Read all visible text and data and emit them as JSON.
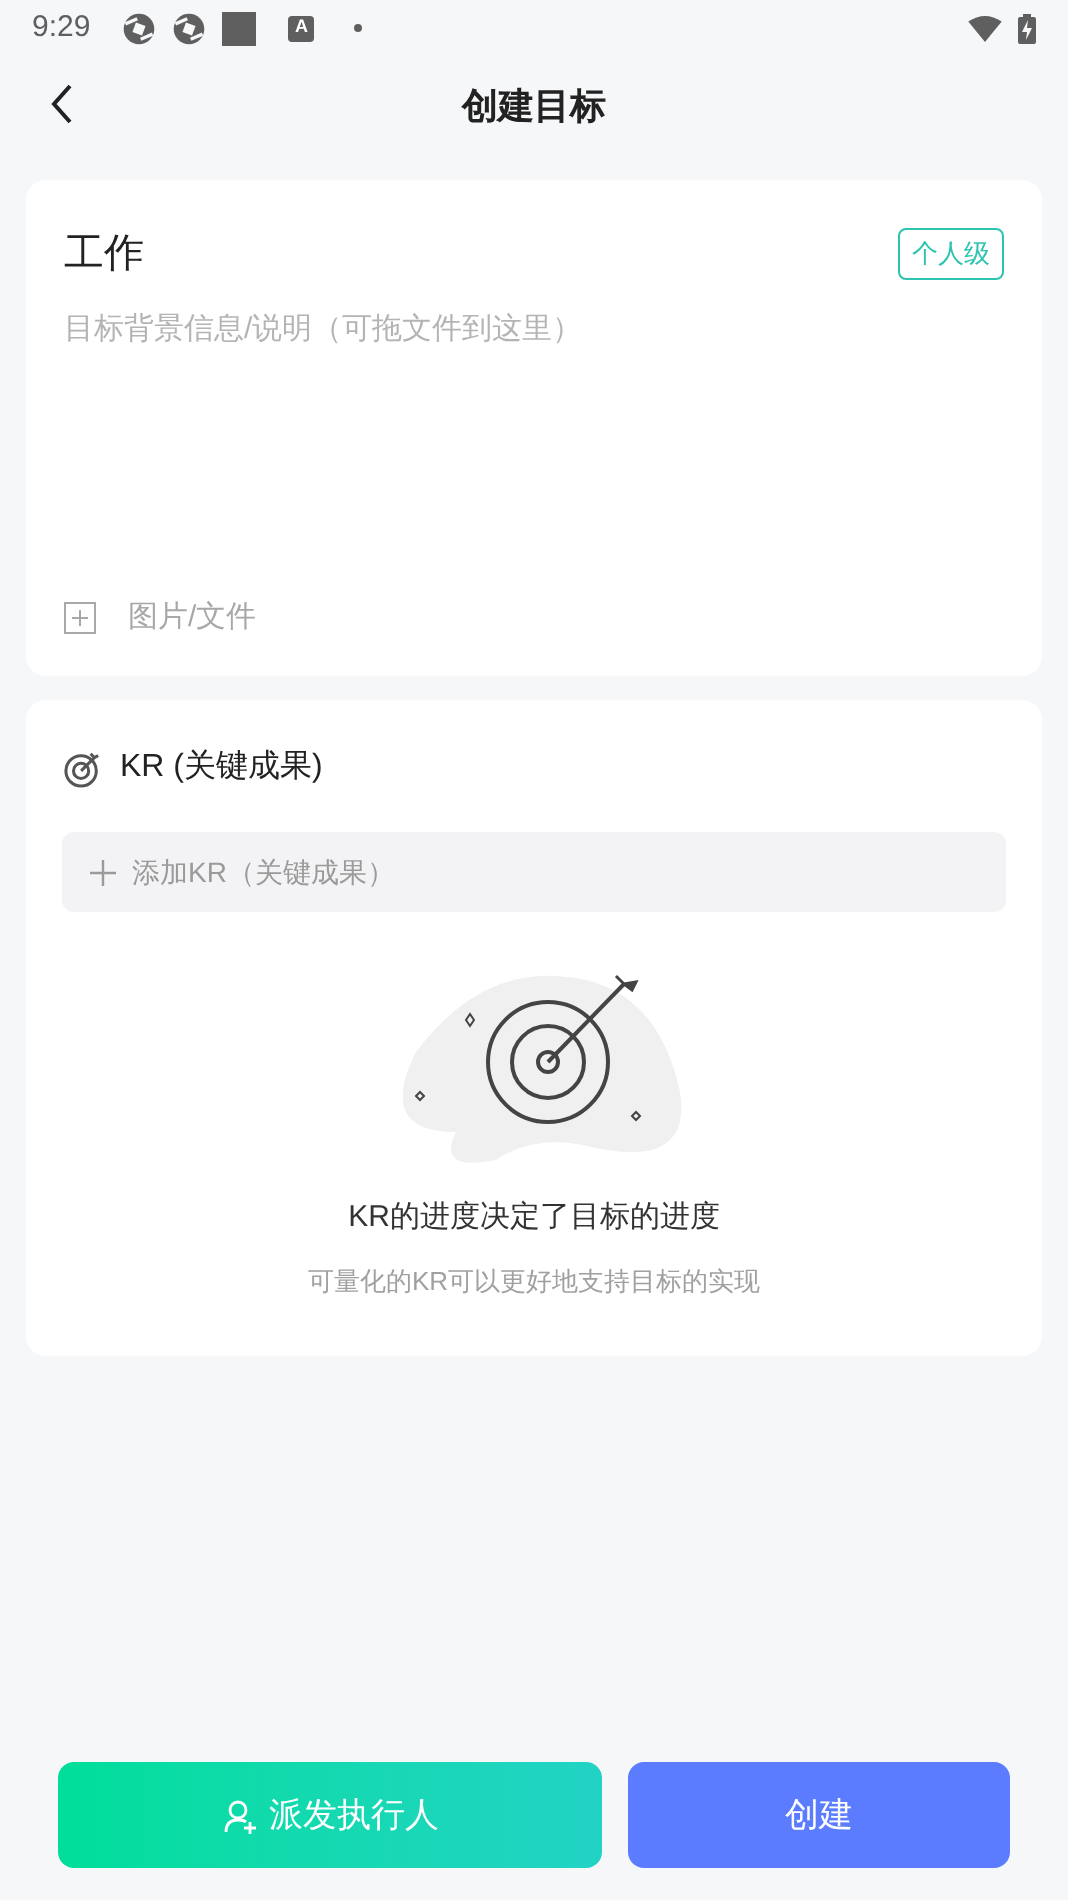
{
  "status_bar": {
    "time": "9:29",
    "app_badge_letter": "A"
  },
  "header": {
    "title": "创建目标"
  },
  "goal_card": {
    "title": "工作",
    "level_tag": "个人级",
    "description_placeholder": "目标背景信息/说明（可拖文件到这里）",
    "attach_label": "图片/文件"
  },
  "kr_card": {
    "title": "KR (关键成果)",
    "add_label": "添加KR（关键成果）",
    "empty_title": "KR的进度决定了目标的进度",
    "empty_subtitle": "可量化的KR可以更好地支持目标的实现"
  },
  "buttons": [
    {
      "kind": "assign",
      "label": "派发执行人"
    },
    {
      "kind": "create",
      "label": "创建"
    }
  ]
}
